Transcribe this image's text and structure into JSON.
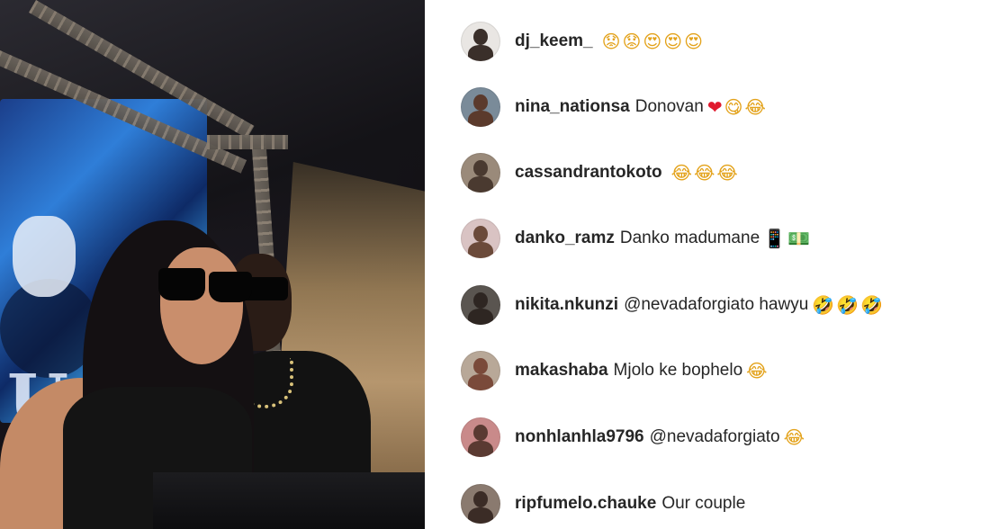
{
  "photo": {
    "description_icon": "event-photo-icon",
    "screen_text": "U O"
  },
  "comments": [
    {
      "username": "dj_keem_",
      "text": "",
      "emojis": [
        "😟",
        "😟",
        "😍",
        "😍",
        "😍"
      ],
      "avatar_colors": [
        "#3a2f2a",
        "#e9e6e3"
      ]
    },
    {
      "username": "nina_nationsa",
      "text": "Donovan",
      "emojis": [
        "❤",
        "😋",
        "😂"
      ],
      "avatar_colors": [
        "#5b3a2c",
        "#7a8b99"
      ]
    },
    {
      "username": "cassandrantokoto",
      "text": "",
      "emojis": [
        "😂",
        "😂",
        "😂"
      ],
      "avatar_colors": [
        "#4a3a30",
        "#9a8a7a"
      ]
    },
    {
      "username": "danko_ramz",
      "text": "Danko madumane",
      "emojis": [
        "📱",
        "💵"
      ],
      "avatar_colors": [
        "#6b4a3a",
        "#d9c3c3"
      ]
    },
    {
      "username": "nikita.nkunzi",
      "text": "@nevadaforgiato hawyu",
      "emojis": [
        "🤣",
        "🤣",
        "🤣"
      ],
      "avatar_colors": [
        "#2e2622",
        "#5a5550"
      ]
    },
    {
      "username": "makashaba",
      "text": "Mjolo ke bophelo",
      "emojis": [
        "😂"
      ],
      "avatar_colors": [
        "#7a4a3a",
        "#b8a898"
      ]
    },
    {
      "username": "nonhlanhla9796",
      "text": "@nevadaforgiato",
      "emojis": [
        "😂"
      ],
      "avatar_colors": [
        "#5a3a32",
        "#c98a8a"
      ]
    },
    {
      "username": "ripfumelo.chauke",
      "text": "Our couple",
      "emojis": [],
      "avatar_colors": [
        "#3b2c26",
        "#8a7a6f"
      ]
    }
  ]
}
